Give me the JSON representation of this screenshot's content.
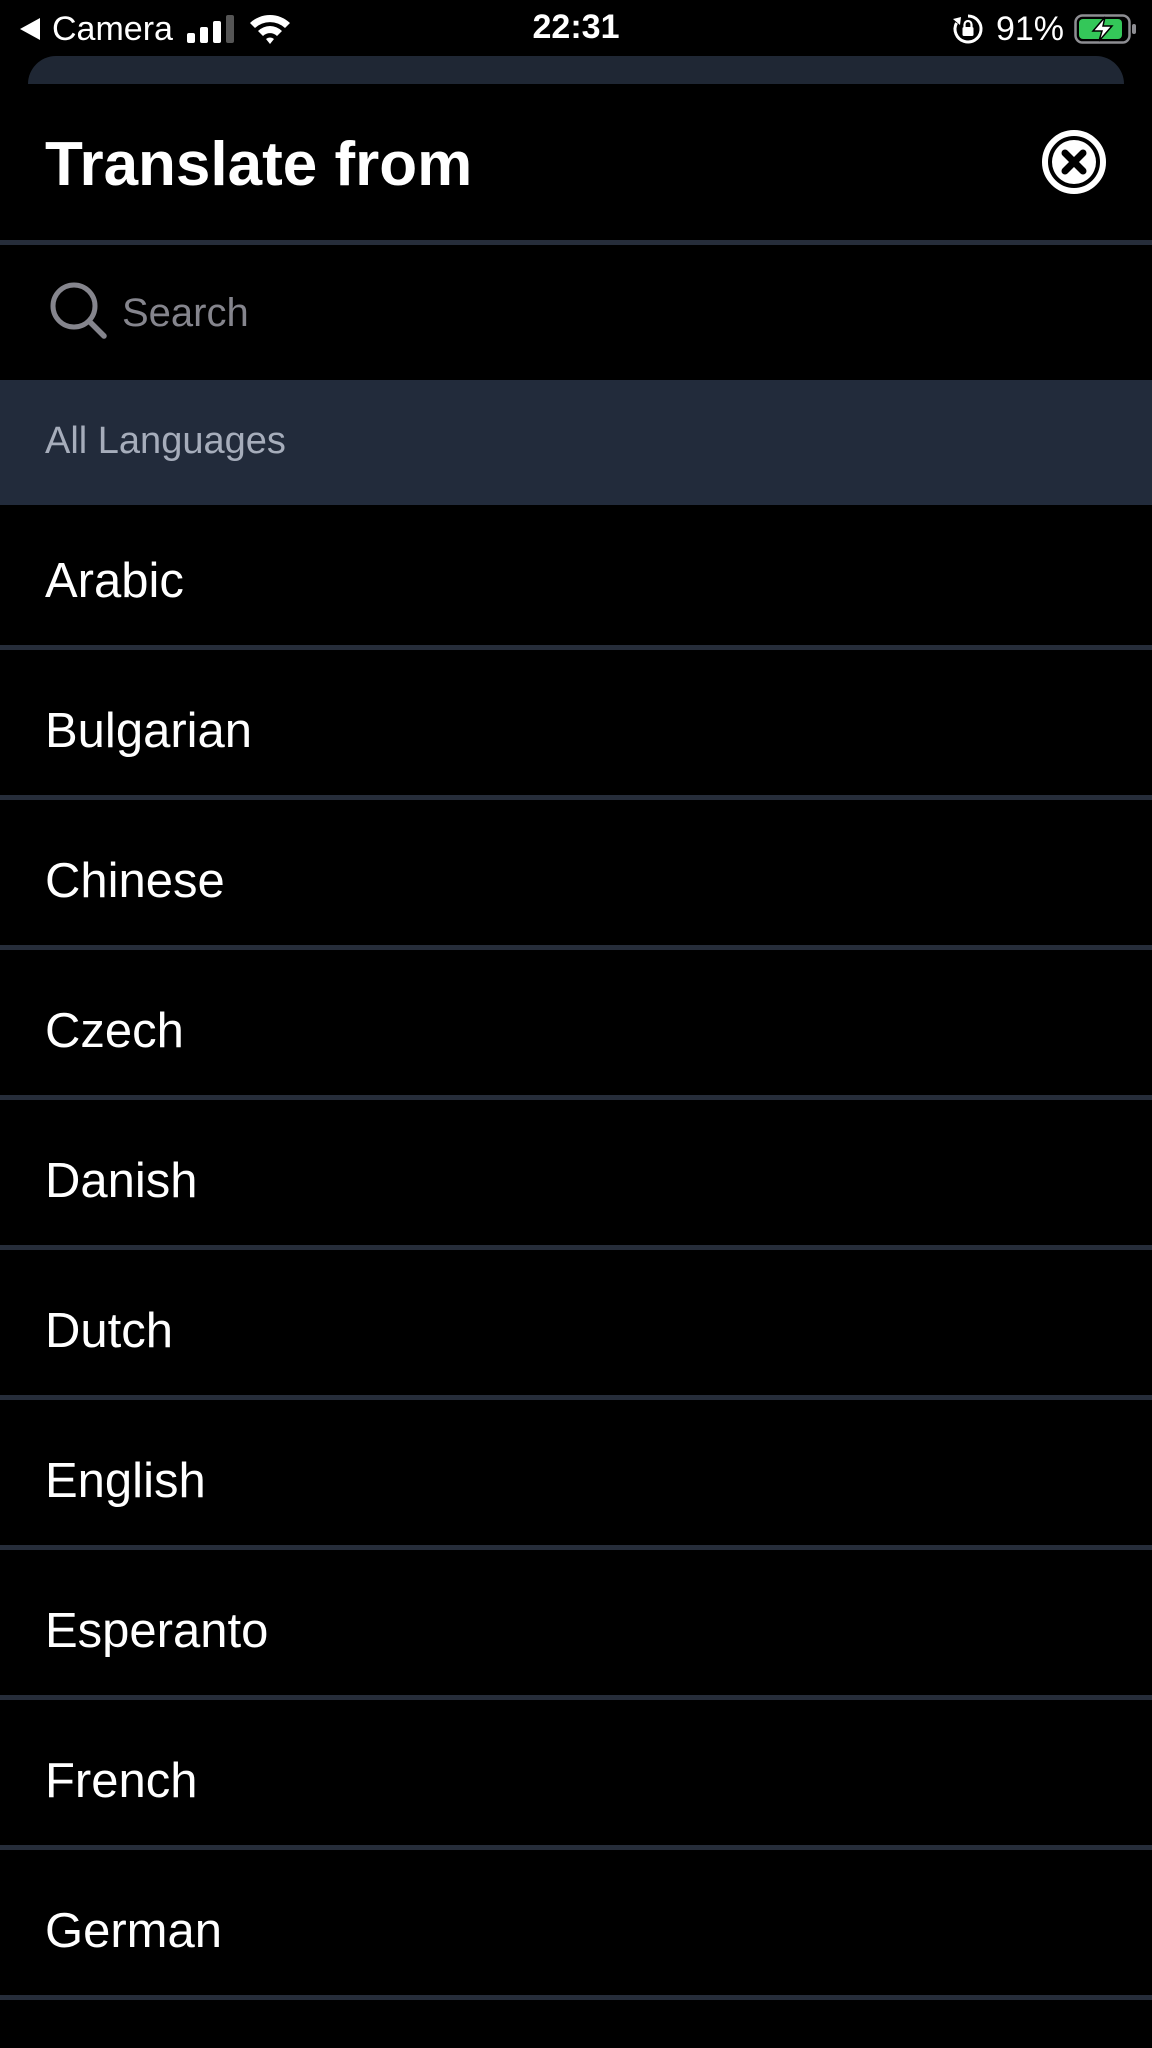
{
  "status_bar": {
    "back_app": "Camera",
    "time": "22:31",
    "battery_percent": "91%",
    "signal_bars": 3,
    "signal_bars_total": 4,
    "battery_level": 0.91,
    "battery_color": "#34c759",
    "charging": true
  },
  "header": {
    "title": "Translate from",
    "close_icon": "close-circle-icon"
  },
  "search": {
    "placeholder": "Search",
    "value": "",
    "icon": "search-icon"
  },
  "section": {
    "label": "All Languages"
  },
  "languages": [
    {
      "label": "Arabic"
    },
    {
      "label": "Bulgarian"
    },
    {
      "label": "Chinese"
    },
    {
      "label": "Czech"
    },
    {
      "label": "Danish"
    },
    {
      "label": "Dutch"
    },
    {
      "label": "English"
    },
    {
      "label": "Esperanto"
    },
    {
      "label": "French"
    },
    {
      "label": "German"
    }
  ],
  "colors": {
    "background": "#000000",
    "divider": "#262d3a",
    "section_background": "#222b3b",
    "section_text": "#a6adbb",
    "placeholder": "#85858d"
  }
}
